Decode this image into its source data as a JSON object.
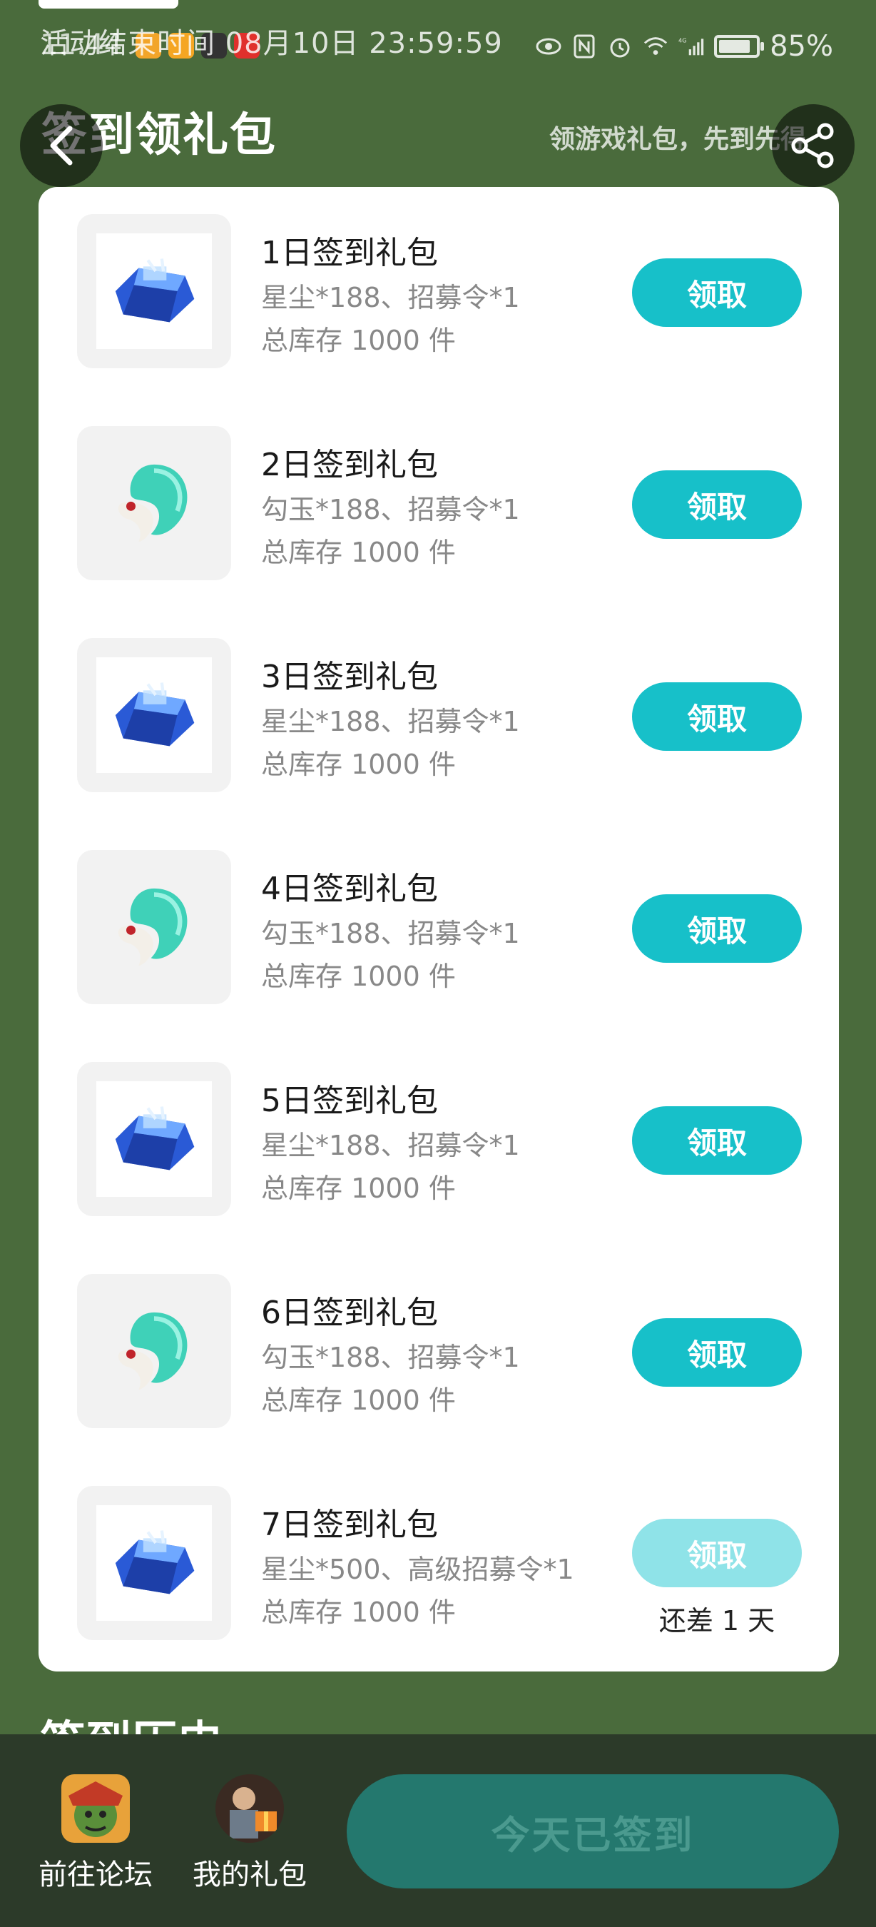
{
  "status_bar": {
    "time": "11:44",
    "battery_label": "85%",
    "battery_level": 0.85,
    "network_label": "4G"
  },
  "activity": {
    "end_time_text": "活动结束时间 08月10日 23:59:59"
  },
  "header": {
    "title": "签到领礼包",
    "subtitle": "领游戏礼包，先到先得"
  },
  "gifts": [
    {
      "title": "1日签到礼包",
      "desc": "星尘*188、招募令*1",
      "stock": "总库存 1000 件",
      "icon": "stardust-crystal-icon",
      "button": "领取",
      "enabled": true
    },
    {
      "title": "2日签到礼包",
      "desc": "勾玉*188、招募令*1",
      "stock": "总库存 1000 件",
      "icon": "magatama-jade-icon",
      "button": "领取",
      "enabled": true
    },
    {
      "title": "3日签到礼包",
      "desc": "星尘*188、招募令*1",
      "stock": "总库存 1000 件",
      "icon": "stardust-crystal-icon",
      "button": "领取",
      "enabled": true
    },
    {
      "title": "4日签到礼包",
      "desc": "勾玉*188、招募令*1",
      "stock": "总库存 1000 件",
      "icon": "magatama-jade-icon",
      "button": "领取",
      "enabled": true
    },
    {
      "title": "5日签到礼包",
      "desc": "星尘*188、招募令*1",
      "stock": "总库存 1000 件",
      "icon": "stardust-crystal-icon",
      "button": "领取",
      "enabled": true
    },
    {
      "title": "6日签到礼包",
      "desc": "勾玉*188、招募令*1",
      "stock": "总库存 1000 件",
      "icon": "magatama-jade-icon",
      "button": "领取",
      "enabled": true
    },
    {
      "title": "7日签到礼包",
      "desc": "星尘*500、高级招募令*1",
      "stock": "总库存 1000 件",
      "icon": "stardust-crystal-icon",
      "button": "领取",
      "enabled": false,
      "remaining": "还差 1 天"
    }
  ],
  "history": {
    "heading": "签到历史"
  },
  "bottom_bar": {
    "forum_label": "前往论坛",
    "my_gifts_label": "我的礼包",
    "signed_label": "今天已签到"
  },
  "colors": {
    "page_bg": "#4a6b3c",
    "accent": "#17c0c9",
    "accent_disabled": "#8fe3e8",
    "bottom_bg": "#2c3a29",
    "signed_button": "#24786e"
  }
}
